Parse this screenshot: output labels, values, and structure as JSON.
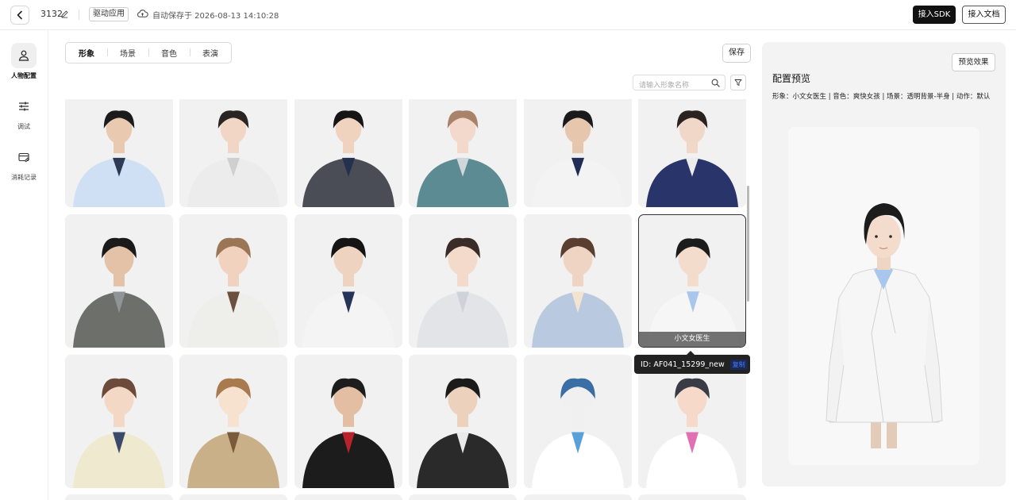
{
  "header": {
    "project_name": "3132",
    "drive_tag": "驱动应用",
    "autosave_text": "自动保存于 2026-08-13 14:10:28",
    "sdk_button": "接入SDK",
    "doc_button": "接入文档"
  },
  "sidebar": {
    "items": [
      {
        "label": "人物配置",
        "icon": "person-icon",
        "active": true
      },
      {
        "label": "调试",
        "icon": "sliders-icon",
        "active": false
      },
      {
        "label": "消耗记录",
        "icon": "wallet-icon",
        "active": false
      }
    ]
  },
  "tabs": [
    {
      "label": "形象",
      "active": true
    },
    {
      "label": "场景",
      "active": false
    },
    {
      "label": "音色",
      "active": false
    },
    {
      "label": "表演",
      "active": false
    }
  ],
  "save_button": "保存",
  "search": {
    "placeholder": "请输入形象名称"
  },
  "selected_avatar": {
    "name": "小文女医生",
    "id_text": "ID: AF041_15299_new",
    "copy_label": "复制"
  },
  "preview": {
    "button": "预览效果",
    "title": "配置预览",
    "summary": "形象：小文女医生 | 音色：爽快女孩 | 场景：透明背景-半身 | 动作：默认"
  },
  "colors": {
    "primary_button": "#111111",
    "panel_bg": "#f3f3f3",
    "card_bg": "#f1f1f1",
    "copy_link": "#4a7bff"
  }
}
